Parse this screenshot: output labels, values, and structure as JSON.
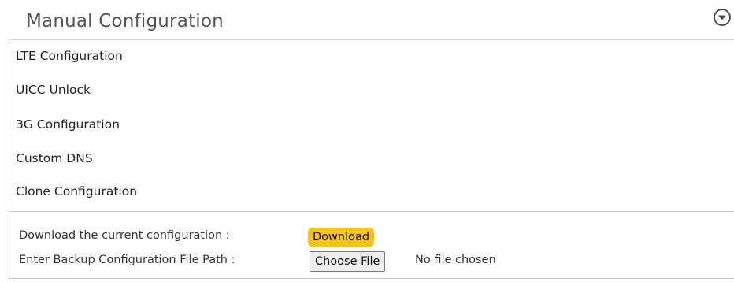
{
  "section": {
    "title": "Manual Configuration",
    "toggle_icon": "chevron-down-circle-icon"
  },
  "menu": {
    "items": [
      {
        "label": "LTE Configuration"
      },
      {
        "label": "UICC Unlock"
      },
      {
        "label": "3G Configuration"
      },
      {
        "label": "Custom DNS"
      },
      {
        "label": "Clone Configuration"
      }
    ]
  },
  "backup": {
    "download_label": "Download the current configuration :",
    "download_button": "Download",
    "file_path_label": "Enter Backup Configuration File Path :",
    "choose_file_button": "Choose File",
    "file_status": "No file chosen"
  },
  "colors": {
    "accent": "#f6c31c",
    "border": "#d3d3d3"
  }
}
